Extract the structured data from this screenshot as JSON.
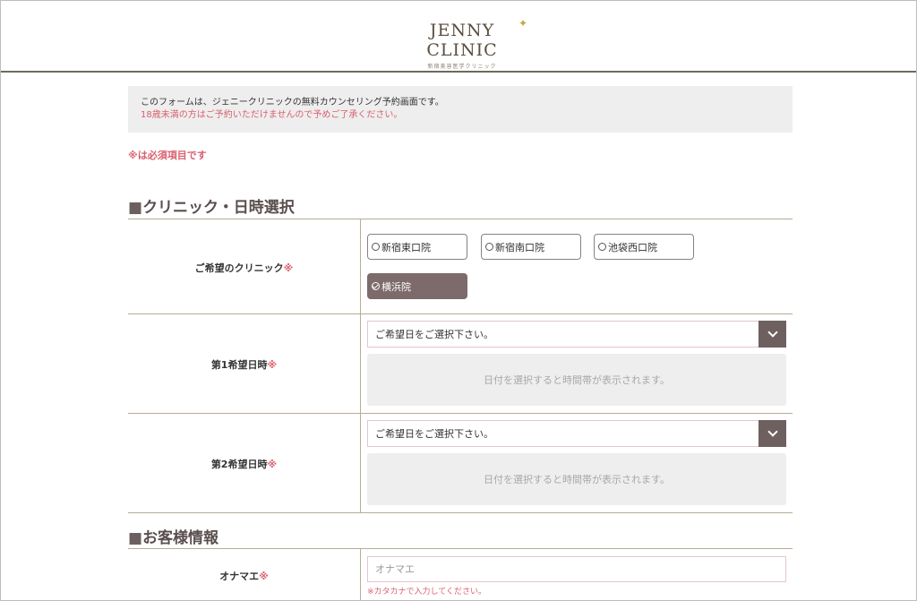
{
  "header": {
    "logo_text": "JENNY CLINIC",
    "logo_sub": "新宿美容医学クリニック"
  },
  "notice": {
    "line1": "このフォームは、ジェニークリニックの無料カウンセリング予約画面です。",
    "line2": "18歳未満の方はご予約いただけませんので予めご了承ください。"
  },
  "required_note": "※は必須項目です",
  "section1": {
    "title": "クリニック・日時選択",
    "clinic_row": {
      "label": "ご希望のクリニック",
      "req": "※",
      "options": [
        {
          "label": "新宿東口院",
          "selected": false
        },
        {
          "label": "新宿南口院",
          "selected": false
        },
        {
          "label": "池袋西口院",
          "selected": false
        },
        {
          "label": "横浜院",
          "selected": true
        }
      ]
    },
    "date1": {
      "label": "第1希望日時",
      "req": "※",
      "select_value": "ご希望日をご選択下さい。",
      "panel_text": "日付を選択すると時間帯が表示されます。"
    },
    "date2": {
      "label": "第2希望日時",
      "req": "※",
      "select_value": "ご希望日をご選択下さい。",
      "panel_text": "日付を選択すると時間帯が表示されます。"
    }
  },
  "section2": {
    "title": "お客様情報",
    "name_row": {
      "label": "オナマエ",
      "req": "※",
      "placeholder": "オナマエ",
      "value": "",
      "hint": "※カタカナで入力してください。"
    }
  },
  "colors": {
    "accent_pink": "#d9606f",
    "brand_brown": "#7d6b6b",
    "rule": "#b6ad95"
  }
}
